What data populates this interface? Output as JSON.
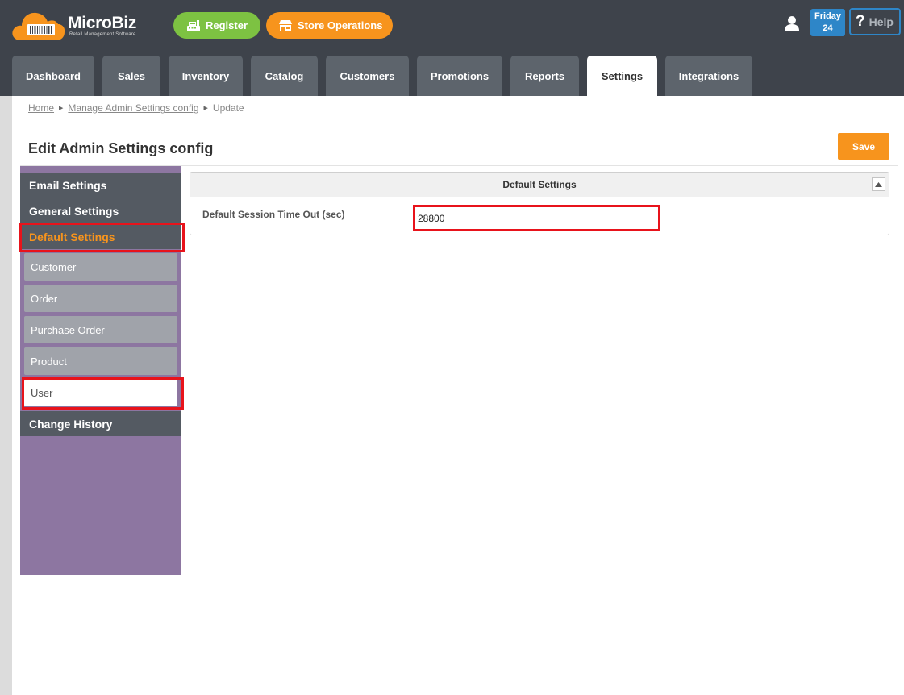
{
  "brand": {
    "name": "MicroBiz",
    "tagline": "Retail Management Software"
  },
  "header": {
    "register_label": "Register",
    "store_ops_label": "Store Operations",
    "date_day": "Friday",
    "date_num": "24",
    "help_label": "Help"
  },
  "tabs": [
    {
      "label": "Dashboard"
    },
    {
      "label": "Sales"
    },
    {
      "label": "Inventory"
    },
    {
      "label": "Catalog"
    },
    {
      "label": "Customers"
    },
    {
      "label": "Promotions"
    },
    {
      "label": "Reports"
    },
    {
      "label": "Settings",
      "active": true
    },
    {
      "label": "Integrations"
    }
  ],
  "breadcrumb": {
    "home": "Home",
    "manage": "Manage Admin Settings config",
    "current": "Update"
  },
  "page": {
    "title": "Edit Admin Settings config",
    "save_label": "Save"
  },
  "sidebar": {
    "sections": [
      {
        "label": "Email Settings"
      },
      {
        "label": "General Settings"
      },
      {
        "label": "Default Settings",
        "active": true
      },
      {
        "label": "Change History"
      }
    ],
    "subitems": [
      {
        "label": "Customer"
      },
      {
        "label": "Order"
      },
      {
        "label": "Purchase Order"
      },
      {
        "label": "Product"
      },
      {
        "label": "User",
        "selected": true
      }
    ]
  },
  "panel": {
    "title": "Default Settings",
    "field_label": "Default Session Time Out (sec)",
    "field_value": "28800"
  },
  "colors": {
    "header_bg": "#3e434b",
    "accent_orange": "#f7941d",
    "accent_green": "#7dc242",
    "accent_blue": "#2e86c8",
    "sidebar_purple": "#8d76a1",
    "highlight_red": "#e8131b"
  },
  "icons": {
    "logo": "cloud-barcode-icon",
    "register": "cash-register-icon",
    "store": "storefront-icon",
    "user": "user-icon",
    "collapse": "triangle-up-icon"
  }
}
